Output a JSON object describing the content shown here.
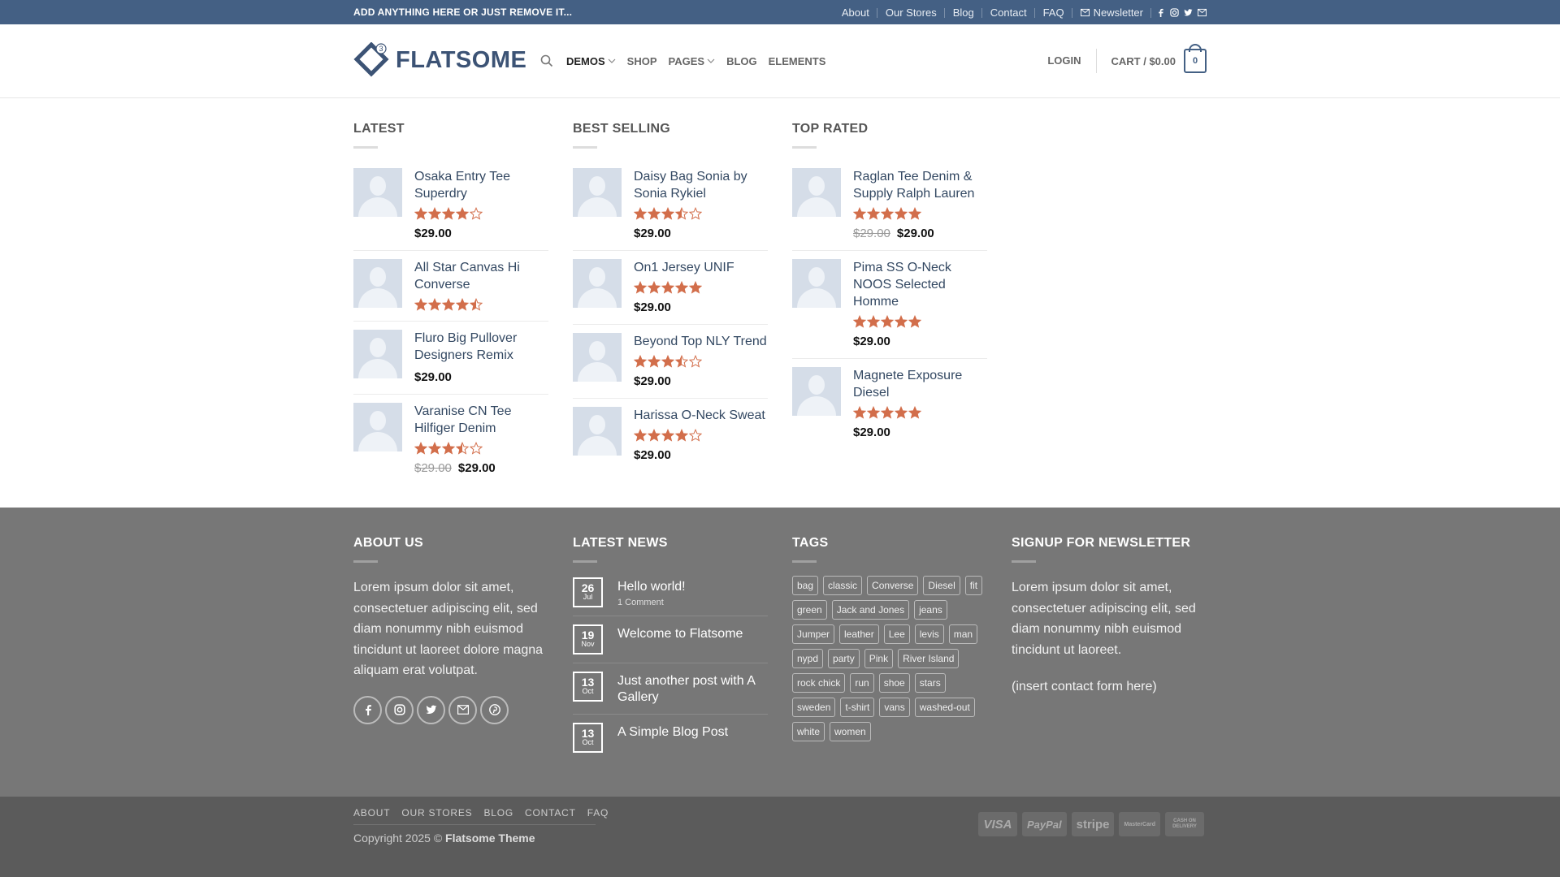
{
  "topbar": {
    "promo": "ADD ANYTHING HERE OR JUST REMOVE IT...",
    "links": [
      "About",
      "Our Stores",
      "Blog",
      "Contact",
      "FAQ"
    ],
    "newsletter": "Newsletter",
    "social_icons": [
      "facebook-icon",
      "instagram-icon",
      "twitter-icon",
      "email-icon"
    ],
    "background": "#446084"
  },
  "header": {
    "logo_text": "FLATSOME",
    "logo_badge": "3",
    "nav": [
      {
        "label": "DEMOS",
        "dropdown": true,
        "active": true
      },
      {
        "label": "SHOP",
        "dropdown": false
      },
      {
        "label": "PAGES",
        "dropdown": true
      },
      {
        "label": "BLOG",
        "dropdown": false
      },
      {
        "label": "ELEMENTS",
        "dropdown": false
      }
    ],
    "login": "LOGIN",
    "cart": "CART / $0.00",
    "cart_count": "0",
    "accent": "#446084"
  },
  "products": {
    "latest": {
      "title": "LATEST",
      "items": [
        {
          "name": "Osaka Entry Tee Superdry",
          "rating": 4,
          "price": "$29.00"
        },
        {
          "name": "All Star Canvas Hi Converse",
          "rating": 4.5,
          "price": ""
        },
        {
          "name": "Fluro Big Pullover Designers Remix",
          "rating": 0,
          "price": "$29.00"
        },
        {
          "name": "Varanise CN Tee Hilfiger Denim",
          "rating": 3.5,
          "old_price": "$29.00",
          "price": "$29.00"
        }
      ]
    },
    "best_selling": {
      "title": "BEST SELLING",
      "items": [
        {
          "name": "Daisy Bag Sonia by Sonia Rykiel",
          "rating": 3.5,
          "price": "$29.00"
        },
        {
          "name": "On1 Jersey UNIF",
          "rating": 5,
          "price": "$29.00"
        },
        {
          "name": "Beyond Top NLY Trend",
          "rating": 3.5,
          "price": "$29.00"
        },
        {
          "name": "Harissa O-Neck Sweat",
          "rating": 4,
          "price": "$29.00"
        }
      ]
    },
    "top_rated": {
      "title": "TOP RATED",
      "items": [
        {
          "name": "Raglan Tee Denim & Supply Ralph Lauren",
          "rating": 5,
          "old_price": "$29.00",
          "price": "$29.00"
        },
        {
          "name": "Pima SS O-Neck NOOS Selected Homme",
          "rating": 5,
          "price": "$29.00"
        },
        {
          "name": "Magnete Exposure Diesel",
          "rating": 5,
          "price": "$29.00"
        }
      ]
    },
    "star_color": "#d26e4b"
  },
  "footer": {
    "about": {
      "title": "ABOUT US",
      "text": "Lorem ipsum dolor sit amet, consectetuer adipiscing elit, sed diam nonummy nibh euismod tincidunt ut laoreet dolore magna aliquam erat volutpat.",
      "social_icons": [
        "facebook-icon",
        "instagram-icon",
        "twitter-icon",
        "email-icon",
        "pinterest-icon"
      ]
    },
    "news": {
      "title": "LATEST NEWS",
      "items": [
        {
          "day": "26",
          "month": "Jul",
          "title": "Hello world!",
          "comments": "1 Comment"
        },
        {
          "day": "19",
          "month": "Nov",
          "title": "Welcome to Flatsome",
          "comments": ""
        },
        {
          "day": "13",
          "month": "Oct",
          "title": "Just another post with A Gallery",
          "comments": ""
        },
        {
          "day": "13",
          "month": "Oct",
          "title": "A Simple Blog Post",
          "comments": ""
        }
      ]
    },
    "tags": {
      "title": "TAGS",
      "items": [
        "bag",
        "classic",
        "Converse",
        "Diesel",
        "fit",
        "green",
        "Jack and Jones",
        "jeans",
        "Jumper",
        "leather",
        "Lee",
        "levis",
        "man",
        "nypd",
        "party",
        "Pink",
        "River Island",
        "rock chick",
        "run",
        "shoe",
        "stars",
        "sweden",
        "t-shirt",
        "vans",
        "washed-out",
        "white",
        "women"
      ]
    },
    "newsletter": {
      "title": "SIGNUP FOR NEWSLETTER",
      "text": "Lorem ipsum dolor sit amet, consectetuer adipiscing elit, sed diam nonummy nibh euismod tincidunt ut laoreet.",
      "form_note": "(insert contact form here)"
    },
    "bottom_nav": [
      "ABOUT",
      "OUR STORES",
      "BLOG",
      "CONTACT",
      "FAQ"
    ],
    "copyright_prefix": "Copyright 2025 ©",
    "copyright_brand": "Flatsome Theme",
    "payments": [
      "VISA",
      "PayPal",
      "stripe",
      "MasterCard",
      "CASH ON DELIVERY"
    ]
  }
}
